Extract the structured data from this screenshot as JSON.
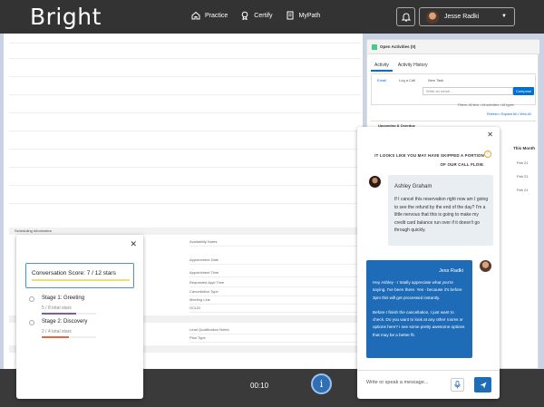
{
  "app": {
    "logo": "Bright"
  },
  "nav": {
    "items": [
      {
        "label": "Practice",
        "icon": "home-icon"
      },
      {
        "label": "Certify",
        "icon": "badge-icon"
      },
      {
        "label": "MyPath",
        "icon": "document-icon"
      }
    ]
  },
  "user": {
    "name": "Jesse Radki"
  },
  "background": {
    "left_fields": [
      "Scheduling Information",
      "Availability Notes",
      "Appointment Date",
      "Appointment Time",
      "Requested Appt Time",
      "Cancellation Type",
      "Meeting Link",
      "GCLID",
      "Lead Qualification Notes",
      "Plan Type"
    ],
    "right_panel": {
      "header": "Open Activities (0)",
      "tabs": [
        "Activity",
        "Activity History"
      ],
      "subtabs": [
        "Email",
        "Log a Call",
        "New Task"
      ],
      "email_placeholder": "Write an email...",
      "compose_label": "Compose",
      "filters": "Filters: All time • All activities • All types",
      "refresh": "Refresh • Expand All • View All",
      "upcoming": "Upcoming & Overdue",
      "this_month": "This Month",
      "dates": [
        "Feb 21",
        "Feb 21",
        "Feb 21"
      ]
    }
  },
  "timer": {
    "value": "00:10"
  },
  "score": {
    "title": "Conversation Score: 7 / 12 stars",
    "earned": 7,
    "total": 12,
    "stages": [
      {
        "name": "Stage 1: Greeting",
        "stars": "5 / 8 total stars",
        "fraction": 0.625,
        "color": "#7b5ea7"
      },
      {
        "name": "Stage 2: Discovery",
        "stars": "2 / 4 total stars",
        "fraction": 0.5,
        "color": "#e8673c"
      }
    ]
  },
  "chat": {
    "warning": "IT LOOKS LIKE YOU MAY HAVE SKIPPED A PORTION OF OUR CALL FLOW.",
    "incoming": {
      "name": "Ashley Graham",
      "text": "If I cancel this reservation right now am I going to see the refund by the end of the day? I'm a little nervous that this is going to make my credit card balance run over if it doesn't go through quickly."
    },
    "outgoing": {
      "name": "Jess Radki",
      "text1": "Hey Ashley - I totally appreciate what you're saying. I've been there. Yes - because it's before 3pm this will get processed instantly.",
      "text2": "Before I finish the cancellation, I just want to check. Do you want to look at any other rooms or options here? I see some pretty awesome options that may be a better fit."
    },
    "input_placeholder": "Write or speak a message..."
  }
}
